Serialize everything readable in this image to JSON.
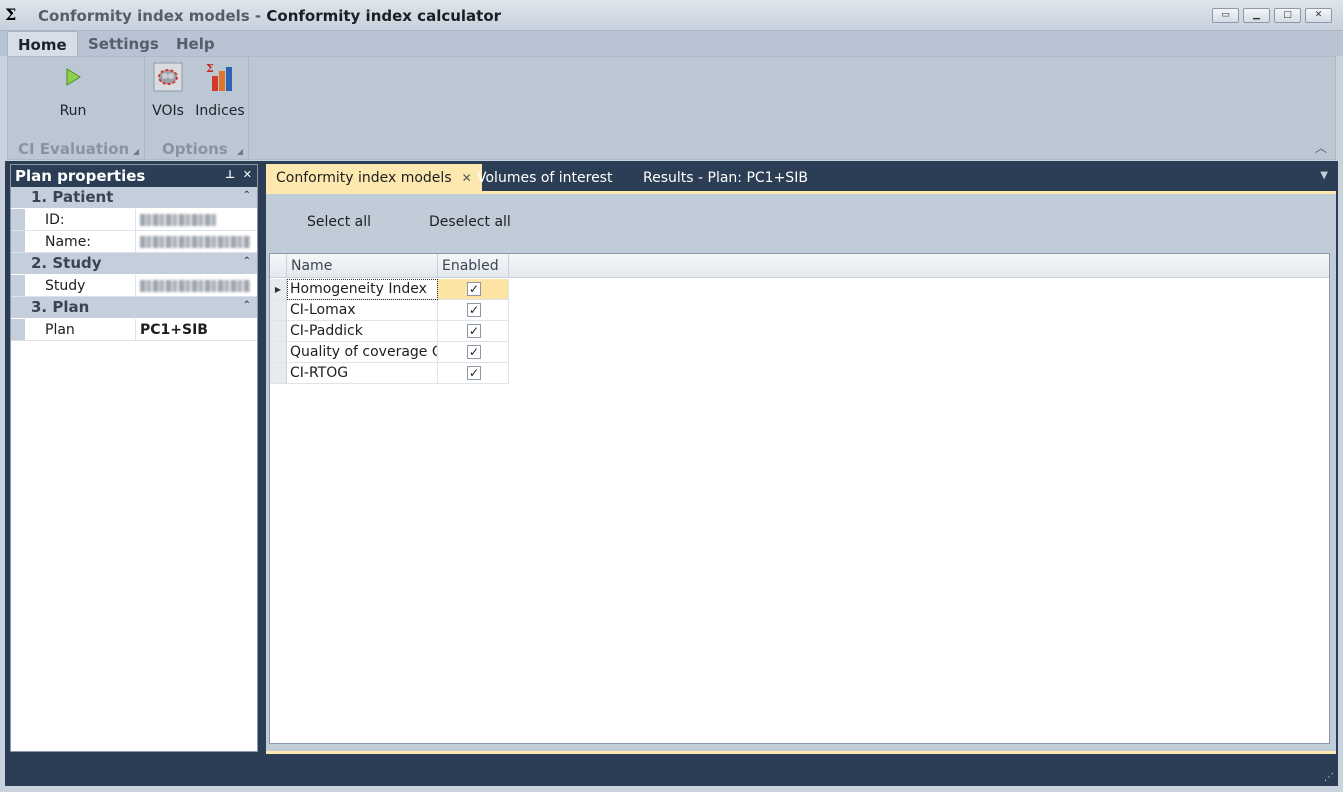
{
  "window": {
    "app_icon": "Σ",
    "title_prefix": "Conformity index models - ",
    "title_main": "Conformity index calculator"
  },
  "ribbon": {
    "tabs": [
      "Home",
      "Settings",
      "Help"
    ],
    "active_tab": "Home",
    "groups": [
      {
        "label": "CI Evaluation",
        "buttons": [
          {
            "label": "Run",
            "icon": "play-icon"
          }
        ]
      },
      {
        "label": "Options",
        "buttons": [
          {
            "label": "VOIs",
            "icon": "voi-icon"
          },
          {
            "label": "Indices",
            "icon": "indices-chart-icon"
          }
        ]
      }
    ]
  },
  "plan_panel": {
    "title": "Plan properties",
    "categories": [
      {
        "label": "1. Patient",
        "props": [
          {
            "name": "ID:",
            "value": ""
          },
          {
            "name": "Name:",
            "value": ""
          }
        ]
      },
      {
        "label": "2. Study",
        "props": [
          {
            "name": "Study",
            "value": ""
          }
        ]
      },
      {
        "label": "3. Plan",
        "props": [
          {
            "name": "Plan",
            "value": "PC1+SIB"
          }
        ]
      }
    ]
  },
  "doc_tabs": [
    {
      "label": "Conformity index models",
      "active": true
    },
    {
      "label": "Volumes of interest",
      "active": false
    },
    {
      "label": "Results - Plan: PC1+SIB",
      "active": false
    }
  ],
  "toolbar": {
    "select_all": "Select all",
    "deselect_all": "Deselect all"
  },
  "grid": {
    "columns": [
      "Name",
      "Enabled"
    ],
    "rows": [
      {
        "name": "Homogeneity Index",
        "enabled": true
      },
      {
        "name": "CI-Lomax",
        "enabled": true
      },
      {
        "name": "CI-Paddick",
        "enabled": true
      },
      {
        "name": "Quality of coverage Q",
        "enabled": true
      },
      {
        "name": "CI-RTOG",
        "enabled": true
      }
    ]
  },
  "colors": {
    "accent": "#fde9b0",
    "dark": "#2c3e55",
    "ribbon": "#bcc7d4"
  }
}
